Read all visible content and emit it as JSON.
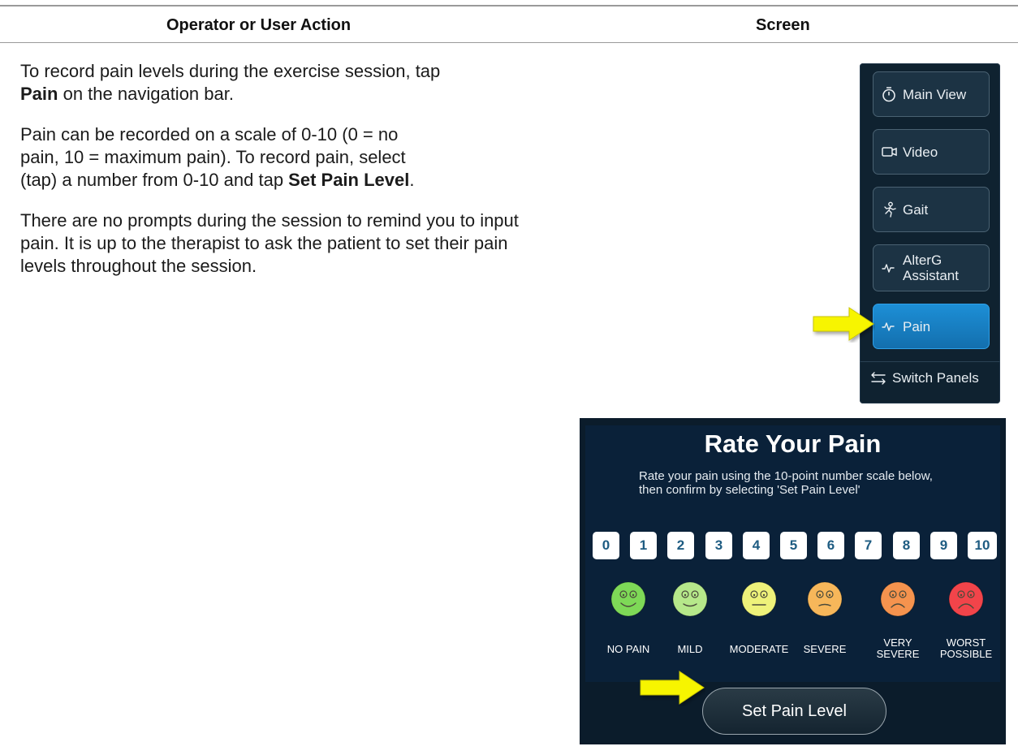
{
  "header": {
    "col_action": "Operator or User Action",
    "col_screen": "Screen"
  },
  "instructions": {
    "p1_pre": "To record pain levels during the exercise session, tap",
    "p1_bold": "Pain",
    "p1_post": " on the navigation bar.",
    "p2_pre": "Pain can be recorded on a scale of 0-10 (0 = no pain, 10 = maximum pain). To record pain, select (tap) a number from 0-10 and tap ",
    "p2_bold": "Set Pain Level",
    "p2_post": ".",
    "p3": "There are no prompts during the session to remind you to input pain. It is up to the therapist to ask the patient to set their pain levels throughout the session."
  },
  "nav": {
    "main_view": "Main View",
    "video": "Video",
    "gait": "Gait",
    "alterg_line1": "AlterG",
    "alterg_line2": "Assistant",
    "pain": "Pain",
    "switch_panels": "Switch Panels",
    "icons": [
      "stopwatch-icon",
      "video-camera-icon",
      "person-walking-icon",
      "pulse-icon",
      "pulse-icon",
      "swap-arrows-icon"
    ],
    "active_color": "#1d8fd6"
  },
  "pain_dialog": {
    "title": "Rate Your Pain",
    "subtitle_line1": "Rate your pain using the 10-point number scale below,",
    "subtitle_line2": "then confirm by selecting 'Set Pain Level'",
    "numbers": [
      "0",
      "1",
      "2",
      "3",
      "4",
      "5",
      "6",
      "7",
      "8",
      "9",
      "10"
    ],
    "faces": [
      {
        "label_line1": "NO PAIN",
        "label_line2": "",
        "color": "#7ed957"
      },
      {
        "label_line1": "MILD",
        "label_line2": "",
        "color": "#b6e88a"
      },
      {
        "label_line1": "MODERATE",
        "label_line2": "",
        "color": "#eef27a"
      },
      {
        "label_line1": "SEVERE",
        "label_line2": "",
        "color": "#f7b75a"
      },
      {
        "label_line1": "VERY",
        "label_line2": "SEVERE",
        "color": "#f5934e"
      },
      {
        "label_line1": "WORST",
        "label_line2": "POSSIBLE",
        "color": "#f2444a"
      }
    ],
    "set_button": "Set Pain Level"
  },
  "callout_color": "#f7f500"
}
